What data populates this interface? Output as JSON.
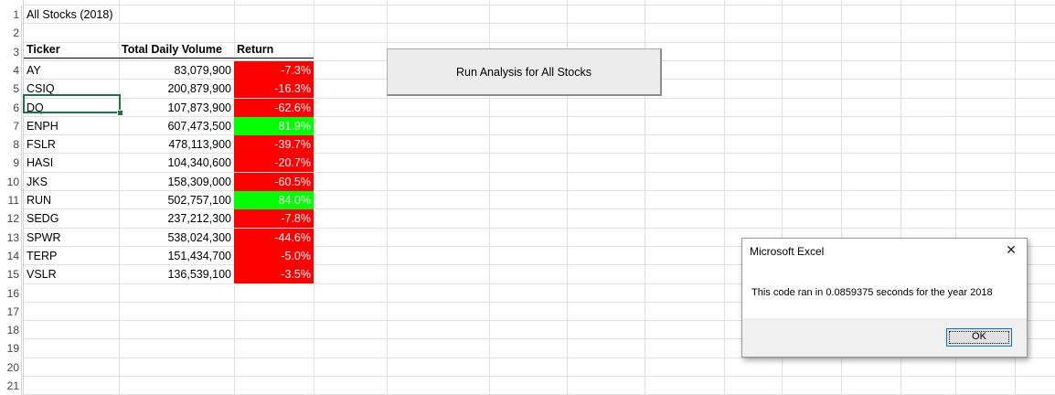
{
  "sheet": {
    "title": "All Stocks (2018)",
    "headers": {
      "ticker": "Ticker",
      "volume": "Total Daily Volume",
      "return": "Return"
    },
    "rows": [
      {
        "ticker": "AY",
        "volume": "83,079,900",
        "return": "-7.3%",
        "status": "negative"
      },
      {
        "ticker": "CSIQ",
        "volume": "200,879,900",
        "return": "-16.3%",
        "status": "negative"
      },
      {
        "ticker": "DQ",
        "volume": "107,873,900",
        "return": "-62.6%",
        "status": "negative"
      },
      {
        "ticker": "ENPH",
        "volume": "607,473,500",
        "return": "81.9%",
        "status": "positive"
      },
      {
        "ticker": "FSLR",
        "volume": "478,113,900",
        "return": "-39.7%",
        "status": "negative"
      },
      {
        "ticker": "HASI",
        "volume": "104,340,600",
        "return": "-20.7%",
        "status": "negative"
      },
      {
        "ticker": "JKS",
        "volume": "158,309,000",
        "return": "-60.5%",
        "status": "negative"
      },
      {
        "ticker": "RUN",
        "volume": "502,757,100",
        "return": "84.0%",
        "status": "positive"
      },
      {
        "ticker": "SEDG",
        "volume": "237,212,300",
        "return": "-7.8%",
        "status": "negative"
      },
      {
        "ticker": "SPWR",
        "volume": "538,024,300",
        "return": "-44.6%",
        "status": "negative"
      },
      {
        "ticker": "TERP",
        "volume": "151,434,700",
        "return": "-5.0%",
        "status": "negative"
      },
      {
        "ticker": "VSLR",
        "volume": "136,539,100",
        "return": "-3.5%",
        "status": "negative"
      }
    ],
    "row_numbers": [
      "1",
      "2",
      "3",
      "4",
      "5",
      "6",
      "7",
      "8",
      "9",
      "10",
      "11",
      "12",
      "13",
      "14",
      "15",
      "16",
      "17",
      "18",
      "19",
      "20",
      "21"
    ],
    "selected_cell": "A6"
  },
  "button": {
    "label": "Run Analysis for All Stocks"
  },
  "dialog": {
    "title": "Microsoft Excel",
    "message": "This code ran in 0.0859375 seconds for the year 2018",
    "ok_label": "OK",
    "close_glyph": "✕"
  },
  "colors": {
    "negative": "#ff0000",
    "positive": "#00ff00",
    "selection": "#217346"
  }
}
